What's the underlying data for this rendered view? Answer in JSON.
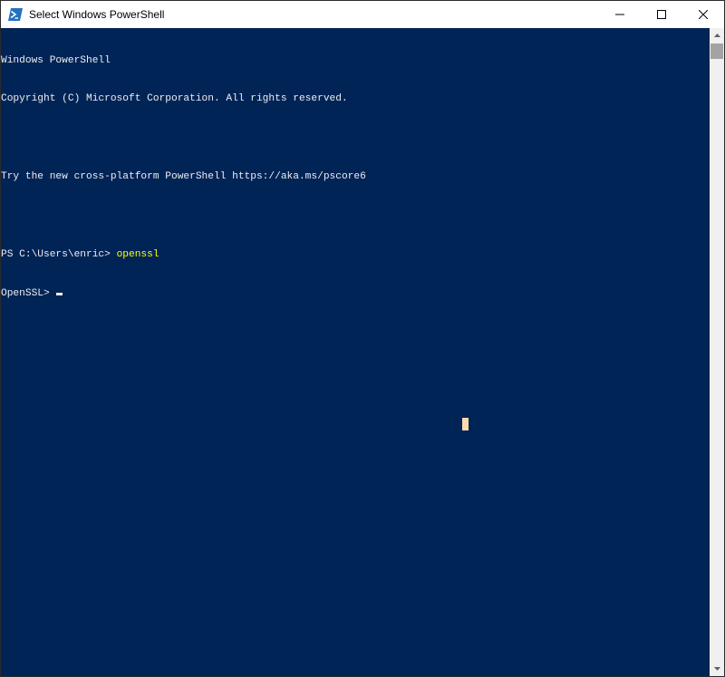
{
  "window": {
    "title": "Select Windows PowerShell",
    "app_icon": "powershell-icon",
    "controls": {
      "minimize_icon": "minimize-icon",
      "maximize_icon": "maximize-icon",
      "close_icon": "close-icon"
    }
  },
  "console": {
    "background": "#012456",
    "foreground": "#eeedf0",
    "command_color": "#ffff00",
    "lines": {
      "l0": "Windows PowerShell",
      "l1": "Copyright (C) Microsoft Corporation. All rights reserved.",
      "l2": "",
      "l3": "Try the new cross-platform PowerShell https://aka.ms/pscore6",
      "l4": "",
      "l5_prompt": "PS C:\\Users\\enric> ",
      "l5_command": "openssl",
      "l6_prompt": "OpenSSL> "
    }
  },
  "scrollbar": {
    "up_icon": "scroll-up-arrow-icon",
    "down_icon": "scroll-down-arrow-icon"
  }
}
